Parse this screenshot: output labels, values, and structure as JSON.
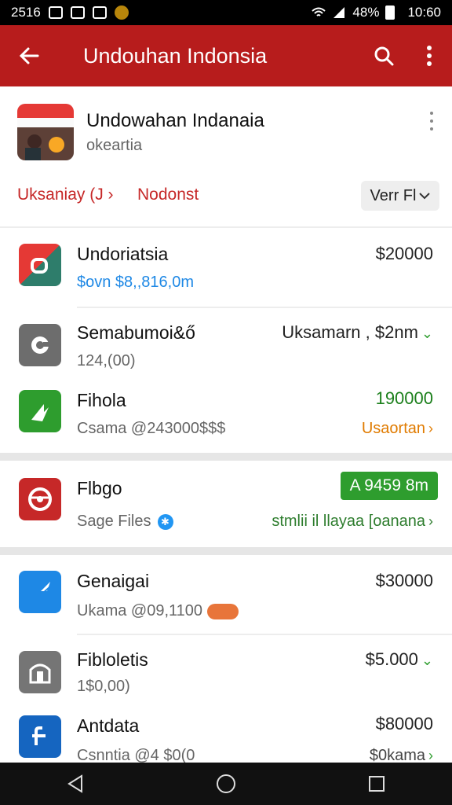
{
  "status_bar": {
    "time_left": "2516",
    "battery": "48%",
    "clock": "10:60"
  },
  "app_bar": {
    "title": "Undouhan Indonsia"
  },
  "header": {
    "title": "Undowahan Indanaia",
    "subtitle": "okeartia",
    "filters": [
      "Uksaniay (J ›",
      "Nodonst"
    ],
    "view_select": "Verr Fl"
  },
  "items": [
    {
      "name": "Undoriatsia",
      "sub": "$ovn $8,,816,0m",
      "right": "$20000",
      "right2": "",
      "icon": "square-red-icon",
      "sub_color": "#1e88e5",
      "right_color": "#222222"
    },
    {
      "name": "Semabumoi&ő",
      "sub": "124,(00)",
      "right": "Uksamarn , $2nm",
      "right2": "",
      "icon": "gear-grey-icon",
      "sub_color": "#666666",
      "right_color": "#222222"
    },
    {
      "name": "Fihola",
      "sub": "Csama @243000$$$",
      "right": "190000",
      "right2": "Usaortan",
      "icon": "arrow-green-icon",
      "sub_color": "#666666",
      "right_color": "#1b7f1b"
    },
    {
      "name": "Flbgo",
      "sub": "Sage Files",
      "right": "A       9459 8m",
      "right2": "stmlii il llayaa [oanana",
      "icon": "wheel-red-icon",
      "sub_color": "#666666",
      "right_color": "#ffffff"
    },
    {
      "name": "Genaigai",
      "sub": "Ukama @09,1100",
      "right": "$30000",
      "right2": "",
      "icon": "wing-blue-icon",
      "sub_color": "#666666",
      "right_color": "#222222"
    },
    {
      "name": "Fibloletis",
      "sub": "1$0,00)",
      "right": "$5.000",
      "right2": "",
      "icon": "building-grey-icon",
      "sub_color": "#666666",
      "right_color": "#222222"
    },
    {
      "name": "Antdata",
      "sub": "Csnntia @4 $0(0",
      "right": "$80000",
      "right2": "$0kama",
      "icon": "cross-blue-icon",
      "sub_color": "#666666",
      "right_color": "#222222"
    }
  ]
}
